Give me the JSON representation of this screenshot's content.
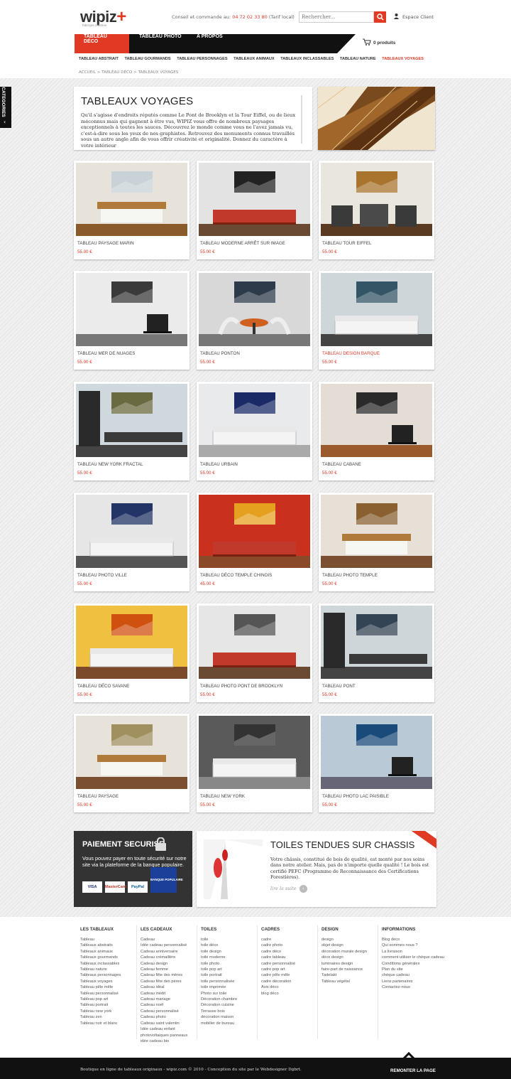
{
  "header": {
    "logo": "wipiz",
    "logo_mark": "+",
    "tagline": "fabrique créative",
    "contact_label": "Conseil et commande au:",
    "contact_phone": "04 72 02 33 80",
    "contact_note": "(Tarif local)",
    "search_placeholder": "Rechercher...",
    "client_label": "Espace Client",
    "cart_label": "0 produits"
  },
  "nav": {
    "items": [
      "TABLEAU DÉCO",
      "TABLEAU PHOTO",
      "A PROPOS"
    ]
  },
  "subnav": [
    "TABLEAU ABSTRAIT",
    "TABLEAU GOURMANDS",
    "TABLEAU PERSONNAGES",
    "TABLEAUX ANIMAUX",
    "TABLEAUX INCLASSABLES",
    "TABLEAU NATURE",
    "TABLEAUX VOYAGES"
  ],
  "breadcrumb": "ACCUEIL > TABLEAU DÉCO > TABLEAUX VOYAGES",
  "categories_tab": "CATEGORIES",
  "intro": {
    "title": "TABLEAUX VOYAGES",
    "text": "Qu'il s'agisse d'endroits réputés comme Le Pont de Brooklyn et la Tour Eiffel, ou de lieux méconnus mais qui gagnent à être vus, WIPIZ vous offre de nombreux paysages exceptionnels à toutes les sauces. Découvrez le monde comme vous ne l'avez jamais vu, c'est-à-dire sous les yeux de nos graphistes. Retrouvez des monuments connus travaillés sous un autre angle afin de vous offrir créativité et originalité. Donnez du caractère à votre intérieur"
  },
  "products": [
    {
      "name": "TABLEAU PAYSAGE MARIN",
      "price": "55.00 €"
    },
    {
      "name": "TABLEAU MODERNE ARRÊT SUR IMAGE",
      "price": "55.00 €"
    },
    {
      "name": "TABLEAU TOUR EIFFEL",
      "price": "55.00 €"
    },
    {
      "name": "TABLEAU MER DE NUAGES",
      "price": "55.00 €"
    },
    {
      "name": "TABLEAU PONTON",
      "price": "55.00 €"
    },
    {
      "name": "TABLEAU DESIGN BARQUE",
      "price": "55.00 €"
    },
    {
      "name": "TABLEAU NEW YORK FRACTAL",
      "price": "55.00 €"
    },
    {
      "name": "TABLEAU URBAIN",
      "price": "55.00 €"
    },
    {
      "name": "TABLEAU CABANE",
      "price": "55.00 €"
    },
    {
      "name": "TABLEAU PHOTO VILLE",
      "price": "55.00 €"
    },
    {
      "name": "TABLEAU DÉCO TEMPLE CHINOIS",
      "price": "45.00 €"
    },
    {
      "name": "TABLEAU PHOTO TEMPLE",
      "price": "55.00 €"
    },
    {
      "name": "TABLEAU DÉCO SAVANE",
      "price": "55.00 €"
    },
    {
      "name": "TABLEAU PHOTO PONT DE BROOKLYN",
      "price": "55.00 €"
    },
    {
      "name": "TABLEAU PONT",
      "price": "55.00 €"
    },
    {
      "name": "TABLEAU PAYSAGE",
      "price": "55.00 €"
    },
    {
      "name": "TABLEAU NEW YORK",
      "price": "55.00 €"
    },
    {
      "name": "TABLEAU PHOTO LAC PAISIBLE",
      "price": "55.00 €"
    }
  ],
  "payment": {
    "title": "PAIEMENT SECURISE",
    "text": "Vous pouvez payer en toute sécurité sur notre site via la plateforme de la banque populaire.",
    "cards": [
      "VISA",
      "MasterCard",
      "PayPal",
      "BANQUE POPULAIRE"
    ]
  },
  "toiles": {
    "title": "TOILES TENDUES SUR CHASSIS",
    "text": "Votre châssis, constitué de bois de qualité, est monté par nos soins dans notre atelier. Mais, pas de n'importe quelle qualité ! Le bois est certifié PEFC (Programme de Reconnaissance des Certifications Forestières).",
    "more": "lire la suite"
  },
  "footer": {
    "columns": [
      {
        "title": "LES TABLEAUX",
        "links": [
          "Tableau",
          "Tableaux abstraits",
          "Tableaux animaux",
          "Tableaux gourmands",
          "Tableaux inclassables",
          "Tableau nature",
          "Tableaux personnages",
          "Tableaux voyages",
          "Tableau pêle mêle",
          "Tableau personnalisé",
          "Tableau pop art",
          "Tableau portrait",
          "Tableau new york",
          "Tableau zen",
          "Tableau noir et blanc"
        ]
      },
      {
        "title": "LES CADEAUX",
        "links": [
          "Cadeau",
          "Idée cadeau personnalisé",
          "Cadeau anniversaire",
          "Cadeau crémaillère",
          "Cadeau design",
          "Cadeau femme",
          "Cadeau fête des mères",
          "Cadeau fête des pères",
          "Cadeau idéal",
          "Cadeau inédit",
          "Cadeau mariage",
          "Cadeau noël",
          "Cadeau personnalisé",
          "Cadeau photo",
          "Cadeau saint valentin",
          "Idée cadeau enfant",
          "photovoltaiques panneaux",
          "idée cadeau bio"
        ]
      },
      {
        "title": "TOILES",
        "links": [
          "toile",
          "toile déco",
          "toile design",
          "toile moderne",
          "toile photo",
          "toile pop art",
          "toile portrait",
          "toile personnalisée",
          "toile imprimée",
          "Photo sur toile",
          "Décoration chambre",
          "Décoration cuisine",
          "Terrasse bois",
          "décoration maison",
          "mobilier de bureau"
        ]
      },
      {
        "title": "CADRES",
        "links": [
          "cadre",
          "cadre photo",
          "cadre déco",
          "cadre tableau",
          "cadre personnalisé",
          "cadre pop art",
          "cadre pêle mêle",
          "cadre décoration",
          "Avis déco",
          "blog déco"
        ]
      },
      {
        "title": "DESIGN",
        "links": [
          "design",
          "objet design",
          "décoration murale design",
          "déco design",
          "luminaires design",
          "faire-part de naissance",
          "Tadelakt",
          "Tableau végétal"
        ]
      },
      {
        "title": "INFORMATIONS",
        "links": [
          "Blog deco",
          "Qui sommes nous ?",
          "La livraison",
          "comment utiliser le chèque cadeau",
          "Conditions générales",
          "Plan du site",
          "chèque cadeau",
          "Liens partenaires",
          "Contactez-nous"
        ]
      }
    ],
    "copyright": "Boutique en ligne de tableaux originaux - wipiz.com © 2010 - Conception du site par le Webdesigner Dgbrt.",
    "back_to_top": "REMONTER LA PAGE"
  },
  "colors": {
    "accent": "#e03a25",
    "dark": "#111111",
    "background": "#ececec"
  }
}
